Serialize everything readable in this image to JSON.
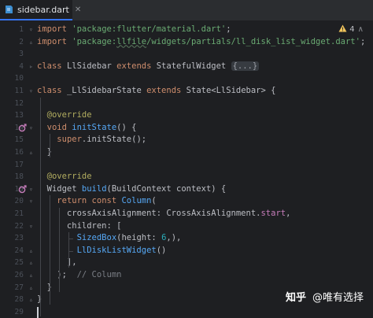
{
  "tab": {
    "filename": "sidebar.dart",
    "close": "✕"
  },
  "inspection": {
    "count": "4",
    "icon": "warning-icon"
  },
  "lines": [
    {
      "n": "1",
      "tokens": [
        {
          "t": "import ",
          "c": "kw"
        },
        {
          "t": "'package:flutter/material.dart'",
          "c": "str"
        },
        {
          "t": ";",
          "c": "cls"
        }
      ]
    },
    {
      "n": "2",
      "tokens": [
        {
          "t": "import ",
          "c": "kw"
        },
        {
          "t": "'package:",
          "c": "str"
        },
        {
          "t": "llfile",
          "c": "str-u"
        },
        {
          "t": "/widgets/partials/ll_disk_list_widget.dart'",
          "c": "str"
        },
        {
          "t": ";",
          "c": "cls"
        }
      ]
    },
    {
      "n": "3",
      "tokens": []
    },
    {
      "n": "4",
      "tokens": [
        {
          "t": "class ",
          "c": "kw"
        },
        {
          "t": "LlSidebar ",
          "c": "cls"
        },
        {
          "t": "extends ",
          "c": "kw"
        },
        {
          "t": "StatefulWidget ",
          "c": "cls"
        },
        {
          "t": "{...}",
          "c": "fold"
        }
      ]
    },
    {
      "n": "10",
      "tokens": []
    },
    {
      "n": "11",
      "tokens": [
        {
          "t": "class ",
          "c": "kw"
        },
        {
          "t": "_LlSidebarState ",
          "c": "cls"
        },
        {
          "t": "extends ",
          "c": "kw"
        },
        {
          "t": "State<LlSidebar> {",
          "c": "cls"
        }
      ]
    },
    {
      "n": "12",
      "tokens": []
    },
    {
      "n": "13",
      "tokens": [
        {
          "t": "  @override",
          "c": "ann"
        }
      ]
    },
    {
      "n": "14",
      "tokens": [
        {
          "t": "  void ",
          "c": "kw"
        },
        {
          "t": "initState",
          "c": "fn"
        },
        {
          "t": "() {",
          "c": "cls"
        }
      ]
    },
    {
      "n": "15",
      "tokens": [
        {
          "t": "    ",
          "c": "cls"
        },
        {
          "t": "super",
          "c": "kw"
        },
        {
          "t": ".initState();",
          "c": "cls"
        }
      ]
    },
    {
      "n": "16",
      "tokens": [
        {
          "t": "  }",
          "c": "cls"
        }
      ]
    },
    {
      "n": "17",
      "tokens": []
    },
    {
      "n": "18",
      "tokens": [
        {
          "t": "  @override",
          "c": "ann"
        }
      ]
    },
    {
      "n": "19",
      "tokens": [
        {
          "t": "  Widget ",
          "c": "cls"
        },
        {
          "t": "build",
          "c": "fn"
        },
        {
          "t": "(BuildContext context) {",
          "c": "cls"
        }
      ]
    },
    {
      "n": "20",
      "tokens": [
        {
          "t": "    ",
          "c": "cls"
        },
        {
          "t": "return const ",
          "c": "kw"
        },
        {
          "t": "Column",
          "c": "fn"
        },
        {
          "t": "(",
          "c": "cls"
        }
      ]
    },
    {
      "n": "21",
      "tokens": [
        {
          "t": "      crossAxisAlignment: CrossAxisAlignment.",
          "c": "cls"
        },
        {
          "t": "start",
          "c": "const"
        },
        {
          "t": ",",
          "c": "cls"
        }
      ]
    },
    {
      "n": "22",
      "tokens": [
        {
          "t": "      children: [",
          "c": "cls"
        }
      ]
    },
    {
      "n": "23",
      "tokens": [
        {
          "t": "        ",
          "c": "cls"
        },
        {
          "t": "SizedBox",
          "c": "fn"
        },
        {
          "t": "(height: ",
          "c": "cls"
        },
        {
          "t": "6",
          "c": "num"
        },
        {
          "t": ",),",
          "c": "cls"
        }
      ]
    },
    {
      "n": "24",
      "tokens": [
        {
          "t": "        ",
          "c": "cls"
        },
        {
          "t": "LlDiskListWidget",
          "c": "fn"
        },
        {
          "t": "()",
          "c": "cls"
        }
      ]
    },
    {
      "n": "25",
      "tokens": [
        {
          "t": "      ],",
          "c": "cls"
        }
      ]
    },
    {
      "n": "26",
      "tokens": [
        {
          "t": "    );  ",
          "c": "cls"
        },
        {
          "t": "// Column",
          "c": "cm"
        }
      ]
    },
    {
      "n": "27",
      "tokens": [
        {
          "t": "  }",
          "c": "cls"
        }
      ]
    },
    {
      "n": "28",
      "tokens": [
        {
          "t": "}",
          "c": "cls"
        }
      ]
    },
    {
      "n": "29",
      "tokens": []
    }
  ],
  "watermark": {
    "logo": "知乎",
    "handle": "@唯有选择"
  },
  "colors": {
    "accent": "#3574f0",
    "background": "#1e1f22"
  }
}
